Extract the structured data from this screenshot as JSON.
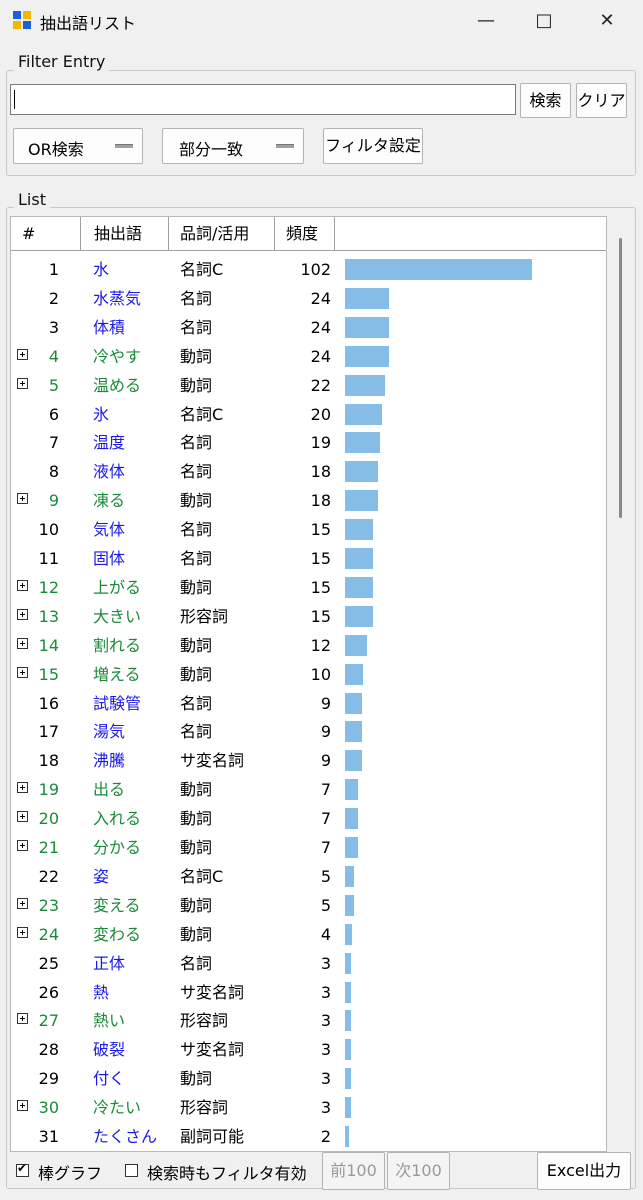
{
  "window": {
    "title": "抽出語リスト",
    "min_icon": "minimize-icon",
    "max_icon": "maximize-icon",
    "close_icon": "close-icon"
  },
  "filter": {
    "legend": "Filter Entry",
    "search_value": "",
    "search_btn": "検索",
    "clear_btn": "クリア",
    "mode_select": "OR検索",
    "match_select": "部分一致",
    "settings_btn": "フィルタ設定"
  },
  "list": {
    "legend": "List",
    "headers": {
      "num": "#",
      "word": "抽出語",
      "pos": "品詞/活用",
      "freq": "頻度"
    },
    "max_freq": 102,
    "rows": [
      {
        "n": "1",
        "w": "水",
        "p": "名詞C",
        "f": "102",
        "v": 102,
        "x": false
      },
      {
        "n": "2",
        "w": "水蒸気",
        "p": "名詞",
        "f": "24",
        "v": 24,
        "x": false
      },
      {
        "n": "3",
        "w": "体積",
        "p": "名詞",
        "f": "24",
        "v": 24,
        "x": false
      },
      {
        "n": "4",
        "w": "冷やす",
        "p": "動詞",
        "f": "24",
        "v": 24,
        "x": true
      },
      {
        "n": "5",
        "w": "温める",
        "p": "動詞",
        "f": "22",
        "v": 22,
        "x": true
      },
      {
        "n": "6",
        "w": "氷",
        "p": "名詞C",
        "f": "20",
        "v": 20,
        "x": false
      },
      {
        "n": "7",
        "w": "温度",
        "p": "名詞",
        "f": "19",
        "v": 19,
        "x": false
      },
      {
        "n": "8",
        "w": "液体",
        "p": "名詞",
        "f": "18",
        "v": 18,
        "x": false
      },
      {
        "n": "9",
        "w": "凍る",
        "p": "動詞",
        "f": "18",
        "v": 18,
        "x": true
      },
      {
        "n": "10",
        "w": "気体",
        "p": "名詞",
        "f": "15",
        "v": 15,
        "x": false
      },
      {
        "n": "11",
        "w": "固体",
        "p": "名詞",
        "f": "15",
        "v": 15,
        "x": false
      },
      {
        "n": "12",
        "w": "上がる",
        "p": "動詞",
        "f": "15",
        "v": 15,
        "x": true
      },
      {
        "n": "13",
        "w": "大きい",
        "p": "形容詞",
        "f": "15",
        "v": 15,
        "x": true
      },
      {
        "n": "14",
        "w": "割れる",
        "p": "動詞",
        "f": "12",
        "v": 12,
        "x": true
      },
      {
        "n": "15",
        "w": "増える",
        "p": "動詞",
        "f": "10",
        "v": 10,
        "x": true
      },
      {
        "n": "16",
        "w": "試験管",
        "p": "名詞",
        "f": "9",
        "v": 9,
        "x": false
      },
      {
        "n": "17",
        "w": "湯気",
        "p": "名詞",
        "f": "9",
        "v": 9,
        "x": false
      },
      {
        "n": "18",
        "w": "沸騰",
        "p": "サ変名詞",
        "f": "9",
        "v": 9,
        "x": false
      },
      {
        "n": "19",
        "w": "出る",
        "p": "動詞",
        "f": "7",
        "v": 7,
        "x": true
      },
      {
        "n": "20",
        "w": "入れる",
        "p": "動詞",
        "f": "7",
        "v": 7,
        "x": true
      },
      {
        "n": "21",
        "w": "分かる",
        "p": "動詞",
        "f": "7",
        "v": 7,
        "x": true
      },
      {
        "n": "22",
        "w": "姿",
        "p": "名詞C",
        "f": "5",
        "v": 5,
        "x": false
      },
      {
        "n": "23",
        "w": "変える",
        "p": "動詞",
        "f": "5",
        "v": 5,
        "x": true
      },
      {
        "n": "24",
        "w": "変わる",
        "p": "動詞",
        "f": "4",
        "v": 4,
        "x": true
      },
      {
        "n": "25",
        "w": "正体",
        "p": "名詞",
        "f": "3",
        "v": 3,
        "x": false
      },
      {
        "n": "26",
        "w": "熱",
        "p": "サ変名詞",
        "f": "3",
        "v": 3,
        "x": false
      },
      {
        "n": "27",
        "w": "熱い",
        "p": "形容詞",
        "f": "3",
        "v": 3,
        "x": true
      },
      {
        "n": "28",
        "w": "破裂",
        "p": "サ変名詞",
        "f": "3",
        "v": 3,
        "x": false
      },
      {
        "n": "29",
        "w": "付く",
        "p": "動詞",
        "f": "3",
        "v": 3,
        "x": false
      },
      {
        "n": "30",
        "w": "冷たい",
        "p": "形容詞",
        "f": "3",
        "v": 3,
        "x": true
      },
      {
        "n": "31",
        "w": "たくさん",
        "p": "副詞可能",
        "f": "2",
        "v": 2,
        "x": false
      }
    ]
  },
  "footer": {
    "bar_graph_label": "棒グラフ",
    "bar_graph_checked": true,
    "filter_on_search_label": "検索時もフィルタ有効",
    "filter_on_search_checked": false,
    "prev_btn": "前100",
    "next_btn": "次100",
    "excel_btn": "Excel出力"
  },
  "colors": {
    "bar": "#85bde6",
    "word": "#1a1ae6",
    "expandable_word": "#1a8a3a"
  }
}
